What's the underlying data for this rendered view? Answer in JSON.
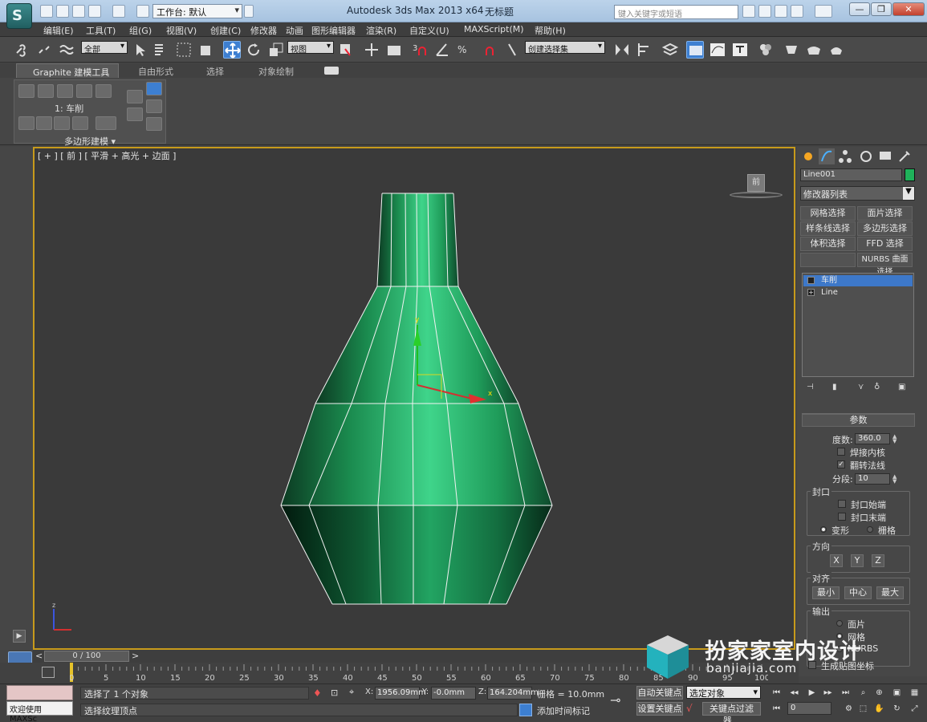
{
  "app": {
    "logo_glyph": "S",
    "title": "Autodesk 3ds Max  2013 x64",
    "document": "无标题",
    "workspace": "工作台: 默认",
    "help_search_placeholder": "键入关键字或短语"
  },
  "window_controls": {
    "minimize": "—",
    "restore": "❐",
    "close": "✕"
  },
  "menu": [
    "编辑(E)",
    "工具(T)",
    "组(G)",
    "视图(V)",
    "创建(C)",
    "修改器",
    "动画",
    "图形编辑器",
    "渲染(R)",
    "自定义(U)",
    "MAXScript(M)",
    "帮助(H)"
  ],
  "toolbar": {
    "selection_filter": "全部",
    "ref_coord": "视图",
    "named_sel_set": "创建选择集"
  },
  "ribbon": {
    "tabs": [
      "Graphite 建模工具",
      "自由形式",
      "选择",
      "对象绘制"
    ],
    "stack_label": "1: 车削",
    "group_label": "多边形建模 ▾"
  },
  "viewport": {
    "label": "[ + ] [ 前 ] [ 平滑 + 高光 + 边面 ]",
    "viewcube_face": "前",
    "gizmo_y": "y",
    "gizmo_x": "x",
    "tripod_z": "z",
    "expand_glyph": "▶"
  },
  "command_panel": {
    "object_name": "Line001",
    "object_color": "#1fb25a",
    "modifier_list": "修改器列表",
    "modifier_buttons": [
      "网格选择",
      "面片选择",
      "样条线选择",
      "多边形选择",
      "体积选择",
      "FFD 选择",
      "",
      "NURBS 曲面选择"
    ],
    "stack": [
      {
        "label": "车削",
        "selected": true
      },
      {
        "label": "Line",
        "selected": false
      }
    ],
    "params": {
      "header": "参数",
      "degrees_label": "度数:",
      "degrees_value": "360.0",
      "weld_core": "焊接内核",
      "weld_core_checked": false,
      "flip_normals": "翻转法线",
      "flip_normals_checked": true,
      "segments_label": "分段:",
      "segments_value": "10",
      "capping_title": "封口",
      "cap_start": "封口始端",
      "cap_end": "封口末端",
      "morph": "变形",
      "grid": "栅格",
      "direction_title": "方向",
      "dir_x": "X",
      "dir_y": "Y",
      "dir_z": "Z",
      "align_title": "对齐",
      "align_min": "最小",
      "align_center": "中心",
      "align_max": "最大",
      "output_title": "输出",
      "out_patch": "面片",
      "out_mesh": "网格",
      "out_nurbs": "NURBS",
      "gen_mapping": "生成贴图坐标"
    }
  },
  "timeline": {
    "slider_text": "0 / 100",
    "prev": "<",
    "next": ">",
    "ticks": [
      "0",
      "5",
      "10",
      "15",
      "20",
      "25",
      "30",
      "35",
      "40",
      "45",
      "50",
      "55",
      "60",
      "65",
      "70",
      "75",
      "80",
      "85",
      "90",
      "95",
      "100"
    ]
  },
  "status": {
    "listener_text": "欢迎使用 MAXSc",
    "selection_msg": "选择了 1 个对象",
    "prompt": "选择纹理顶点",
    "x_label": "X:",
    "x_value": "1956.09mm",
    "y_label": "Y:",
    "y_value": "-0.0mm",
    "z_label": "Z:",
    "z_value": "164.204mm",
    "grid": "栅格 = 10.0mm",
    "add_time_tag": "添加时间标记",
    "auto_key": "自动关键点",
    "set_key": "设置关键点",
    "selected_set": "选定对象",
    "key_filters": "关键点过滤器...",
    "frame_value": "0"
  },
  "watermark": {
    "title": "扮家家室内设计",
    "url": "banjiajia.com"
  }
}
